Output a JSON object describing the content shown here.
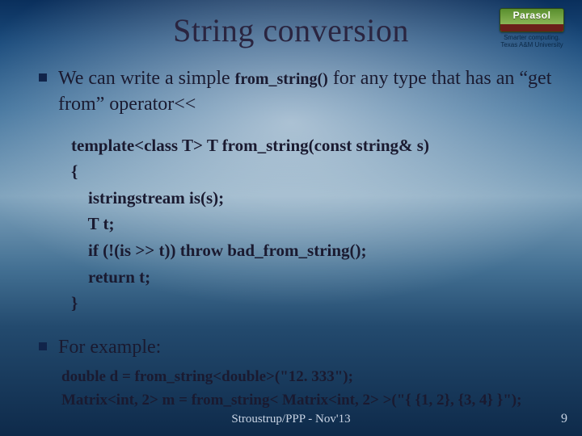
{
  "title": "String conversion",
  "logo": {
    "word": "Parasol",
    "sub1": "Smarter computing.",
    "sub2": "Texas A&M University"
  },
  "bullets": {
    "first": {
      "pre": "We can write a simple ",
      "code": "from_string()",
      "mid": " for any type that has an ",
      "post": "“get from” operator<<"
    },
    "second": "For example:"
  },
  "code": {
    "l1": "template<class T> T from_string(const string& s)",
    "l2": "{",
    "l3": "    istringstream is(s);",
    "l4": "    T t;",
    "l5": "    if (!(is >> t)) throw bad_from_string();",
    "l6": "    return t;",
    "l7": "}"
  },
  "example": {
    "l1": "double d = from_string<double>(\"12. 333\");",
    "l2": "Matrix<int, 2> m = from_string< Matrix<int, 2> >(\"{ {1, 2}, {3, 4} }\");"
  },
  "footer": "Stroustrup/PPP - Nov'13",
  "page": "9"
}
